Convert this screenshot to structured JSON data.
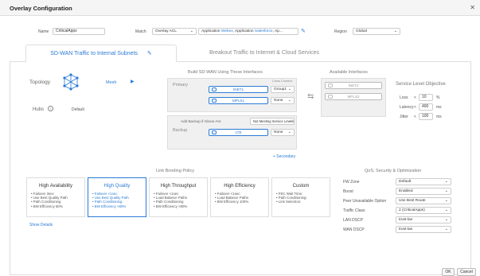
{
  "dialog": {
    "title": "Overlay Configuration"
  },
  "top": {
    "name_label": "Name",
    "name_value": "CriticalApps",
    "match_label": "Match",
    "match_value": "Overlay ACL",
    "apps_prefix": "Application",
    "app1": "Webex",
    "apps_mid": ", Application",
    "app2": "Salesforce",
    "apps_suffix": ", Ap...",
    "region_label": "Region",
    "region_value": "Global"
  },
  "tabs": {
    "active": "SD-WAN Traffic to Internal Subnets",
    "inactive": "Breakout Traffic to Internet & Cloud Services"
  },
  "topology": {
    "label": "Topology",
    "mesh_label": "Mesh",
    "hubs_label": "Hubs",
    "hubs_value": "Default"
  },
  "build": {
    "title": "Build SD-WAN Using These Interfaces",
    "primary_label": "Primary",
    "cross_connect_label": "Cross Connect",
    "primary_rows": [
      {
        "iface": "INET1",
        "opt": "Group1"
      },
      {
        "iface": "MPLS1",
        "opt": "None"
      }
    ],
    "add_backup_label": "Add Backup if Above Are",
    "add_backup_value": "Not Meeting Service Levels",
    "backup_label": "Backup",
    "backup_iface": "LTE",
    "backup_opt": "None",
    "secondary_link": "+ Secondary"
  },
  "available": {
    "title": "Available Interfaces",
    "items": [
      "INET2",
      "MPLS2"
    ]
  },
  "slo": {
    "title": "Service Level Objective",
    "loss_label": "Loss",
    "loss_value": "10",
    "loss_unit": "%",
    "latency_label": "Latency",
    "latency_value": "400",
    "latency_unit": "ms",
    "jitter_label": "Jitter",
    "jitter_value": "100",
    "jitter_unit": "ms",
    "lt": "<"
  },
  "link_bonding": {
    "title": "Link Bonding Policy",
    "cards": [
      {
        "title": "High Availability",
        "items": [
          "Failover 3sec",
          "Use Best Quality Path",
          "Path Conditioning",
          "BW Efficiency 50%"
        ]
      },
      {
        "title": "High Quality",
        "items": [
          "Failover <1sec",
          "Use Best Quality Path",
          "Path Conditioning",
          "BW Efficiency >80%"
        ]
      },
      {
        "title": "High Throughput",
        "items": [
          "Failover <1sec",
          "Load Balance Paths",
          "Path Conditioning",
          "BW Efficiency >80%"
        ]
      },
      {
        "title": "High Efficiency",
        "items": [
          "Failover <1sec",
          "Load Balance Paths",
          "BW Efficiency 100%"
        ]
      },
      {
        "title": "Custom",
        "items": [
          "FEC Wait Time:",
          "Path Conditioning:",
          "Link Selection:"
        ]
      }
    ],
    "show_details": "Show Details"
  },
  "qos": {
    "title": "QoS, Security & Optimization",
    "rows": [
      {
        "label": "FW Zone",
        "value": "Default"
      },
      {
        "label": "Boost",
        "value": "Enabled"
      },
      {
        "label": "Peer Unavailable Option",
        "value": "Use Best Route"
      },
      {
        "label": "Traffic Class",
        "value": "2 (CriticalApps)"
      },
      {
        "label": "LAN DSCP",
        "value": "trust-lan"
      },
      {
        "label": "WAN DSCP",
        "value": "trust-lan"
      }
    ]
  },
  "buttons": {
    "ok": "OK",
    "cancel": "Cancel"
  },
  "colors": {
    "accent": "#2a7bd6",
    "panel": "#f0f0f0"
  }
}
